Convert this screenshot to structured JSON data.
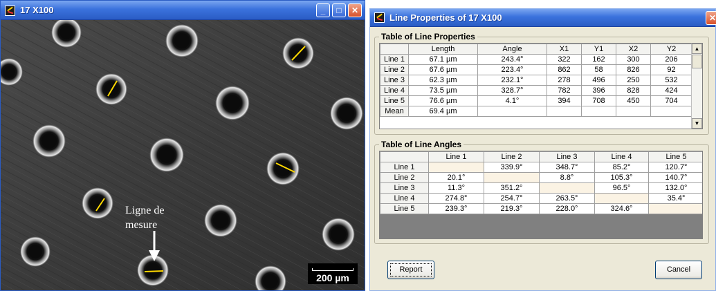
{
  "image_window": {
    "title": "17 X100",
    "annotation_line1": "Ligne de",
    "annotation_line2": "mesure",
    "scale_label": "200 µm"
  },
  "dialog": {
    "title": "Line Properties of 17 X100",
    "properties_group_title": "Table of Line Properties",
    "properties_columns": [
      "",
      "Length",
      "Angle",
      "X1",
      "Y1",
      "X2",
      "Y2"
    ],
    "properties_rows": [
      [
        "Line 1",
        "67.1 µm",
        "243.4°",
        "322",
        "162",
        "300",
        "206"
      ],
      [
        "Line 2",
        "67.6 µm",
        "223.4°",
        "862",
        "58",
        "826",
        "92"
      ],
      [
        "Line 3",
        "62.3 µm",
        "232.1°",
        "278",
        "496",
        "250",
        "532"
      ],
      [
        "Line 4",
        "73.5 µm",
        "328.7°",
        "782",
        "396",
        "828",
        "424"
      ],
      [
        "Line 5",
        "76.6 µm",
        "4.1°",
        "394",
        "708",
        "450",
        "704"
      ],
      [
        "Mean",
        "69.4 µm",
        "",
        "",
        "",
        "",
        ""
      ]
    ],
    "angles_group_title": "Table of Line Angles",
    "angles_columns": [
      "",
      "Line 1",
      "Line 2",
      "Line 3",
      "Line 4",
      "Line 5"
    ],
    "angles_rows": [
      [
        "Line 1",
        "",
        "339.9°",
        "348.7°",
        "85.2°",
        "120.7°"
      ],
      [
        "Line 2",
        "20.1°",
        "",
        "8.8°",
        "105.3°",
        "140.7°"
      ],
      [
        "Line 3",
        "11.3°",
        "351.2°",
        "",
        "96.5°",
        "132.0°"
      ],
      [
        "Line 4",
        "274.8°",
        "254.7°",
        "263.5°",
        "",
        "35.4°"
      ],
      [
        "Line 5",
        "239.3°",
        "219.3°",
        "228.0°",
        "324.6°",
        ""
      ]
    ],
    "report_label": "Report",
    "cancel_label": "Cancel"
  },
  "colors": {
    "titlebar_blue": "#2a5cc4",
    "measure_line": "#ffd800",
    "dialog_face": "#ece9d8"
  }
}
